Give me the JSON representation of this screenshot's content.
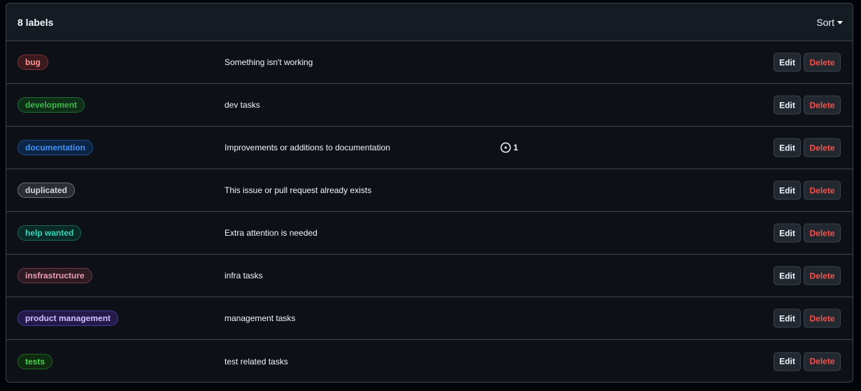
{
  "header": {
    "count_label": "8 labels",
    "sort_label": "Sort"
  },
  "labels": [
    {
      "name": "bug",
      "description": "Something isn't working",
      "text_color": "#ff9492",
      "bg_color": "#3b1a1e",
      "border_color": "#7d3037",
      "edit_label": "Edit",
      "delete_label": "Delete",
      "issues": ""
    },
    {
      "name": "development",
      "description": "dev tasks",
      "text_color": "#3fb950",
      "bg_color": "#0f2e17",
      "border_color": "#1f6f34",
      "edit_label": "Edit",
      "delete_label": "Delete",
      "issues": ""
    },
    {
      "name": "documentation",
      "description": "Improvements or additions to documentation",
      "text_color": "#4493f8",
      "bg_color": "#0c2544",
      "border_color": "#1f4d86",
      "edit_label": "Edit",
      "delete_label": "Delete",
      "issues": "1"
    },
    {
      "name": "duplicated",
      "description": "This issue or pull request already exists",
      "text_color": "#d1d7e0",
      "bg_color": "#2a2e34",
      "border_color": "#6b717a",
      "edit_label": "Edit",
      "delete_label": "Delete",
      "issues": ""
    },
    {
      "name": "help wanted",
      "description": "Extra attention is needed",
      "text_color": "#3ad5b7",
      "bg_color": "#0a2a28",
      "border_color": "#1a665a",
      "edit_label": "Edit",
      "delete_label": "Delete",
      "issues": ""
    },
    {
      "name": "insfrastructure",
      "description": "infra tasks",
      "text_color": "#e8a0b0",
      "bg_color": "#2e1a22",
      "border_color": "#6b3a4a",
      "edit_label": "Edit",
      "delete_label": "Delete",
      "issues": ""
    },
    {
      "name": "product management",
      "description": "management tasks",
      "text_color": "#d2c2ff",
      "bg_color": "#231a4a",
      "border_color": "#4c3a99",
      "edit_label": "Edit",
      "delete_label": "Delete",
      "issues": ""
    },
    {
      "name": "tests",
      "description": "test related tasks",
      "text_color": "#4ad651",
      "bg_color": "#0e2a10",
      "border_color": "#1e6a22",
      "edit_label": "Edit",
      "delete_label": "Delete",
      "issues": ""
    }
  ]
}
